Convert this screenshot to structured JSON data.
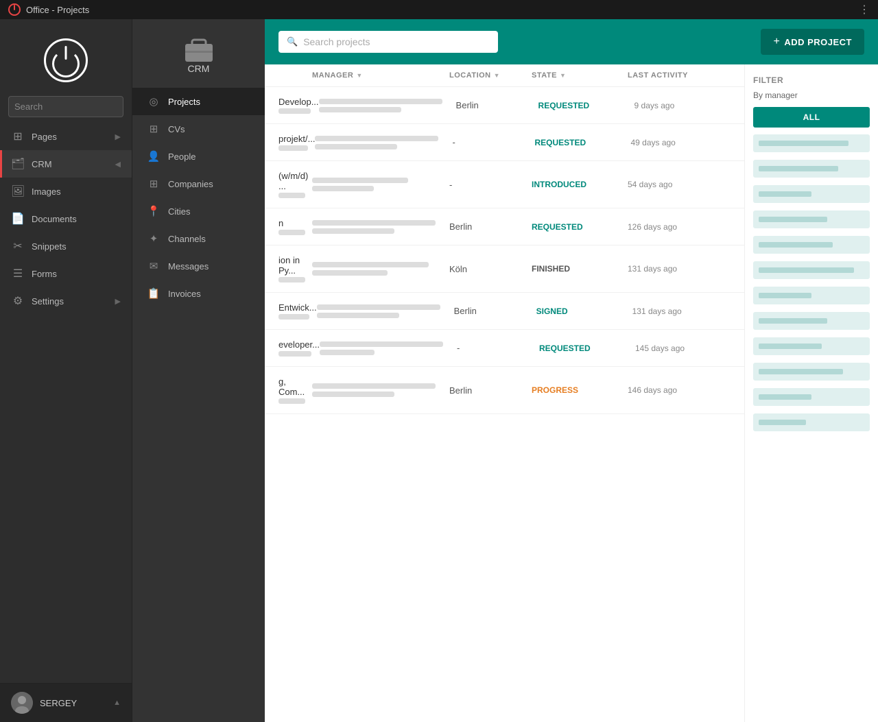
{
  "app": {
    "title": "Office - Projects"
  },
  "left_sidebar": {
    "search_placeholder": "Search",
    "nav_items": [
      {
        "id": "pages",
        "label": "Pages",
        "has_arrow": true
      },
      {
        "id": "crm",
        "label": "CRM",
        "has_arrow": true,
        "active": true
      },
      {
        "id": "images",
        "label": "Images",
        "has_arrow": false
      },
      {
        "id": "documents",
        "label": "Documents",
        "has_arrow": false
      },
      {
        "id": "snippets",
        "label": "Snippets",
        "has_arrow": false
      },
      {
        "id": "forms",
        "label": "Forms",
        "has_arrow": false
      },
      {
        "id": "settings",
        "label": "Settings",
        "has_arrow": true
      }
    ],
    "user": {
      "name": "SERGEY"
    }
  },
  "crm_sidebar": {
    "title": "CRM",
    "items": [
      {
        "id": "projects",
        "label": "Projects",
        "active": true
      },
      {
        "id": "cvs",
        "label": "CVs"
      },
      {
        "id": "people",
        "label": "People"
      },
      {
        "id": "companies",
        "label": "Companies"
      },
      {
        "id": "cities",
        "label": "Cities"
      },
      {
        "id": "channels",
        "label": "Channels"
      },
      {
        "id": "messages",
        "label": "Messages"
      },
      {
        "id": "invoices",
        "label": "Invoices"
      }
    ]
  },
  "header": {
    "search_placeholder": "Search projects",
    "add_button_label": "ADD PROJECT"
  },
  "table": {
    "columns": [
      "MANAGER",
      "LOCATION",
      "STATE",
      "LAST ACTIVITY"
    ],
    "rows": [
      {
        "name": "Develop...",
        "location": "Berlin",
        "state": "REQUESTED",
        "state_class": "state-requested",
        "activity": "9 days ago"
      },
      {
        "name": "projekt/...",
        "location": "-",
        "state": "REQUESTED",
        "state_class": "state-requested",
        "activity": "49 days ago"
      },
      {
        "name": "(w/m/d) ...",
        "location": "-",
        "state": "INTRODUCED",
        "state_class": "state-introduced",
        "activity": "54 days ago"
      },
      {
        "name": "n",
        "location": "Berlin",
        "state": "REQUESTED",
        "state_class": "state-requested",
        "activity": "126 days ago"
      },
      {
        "name": "ion in Py...",
        "location": "Köln",
        "state": "FINISHED",
        "state_class": "state-finished",
        "activity": "131 days ago"
      },
      {
        "name": "Entwick...",
        "location": "Berlin",
        "state": "SIGNED",
        "state_class": "state-signed",
        "activity": "131 days ago"
      },
      {
        "name": "eveloper...",
        "location": "-",
        "state": "REQUESTED",
        "state_class": "state-requested",
        "activity": "145 days ago"
      },
      {
        "name": "g, Com...",
        "location": "Berlin",
        "state": "PROGRESS",
        "state_class": "state-progress",
        "activity": "146 days ago"
      }
    ]
  },
  "filter": {
    "title": "FILTER",
    "subtitle": "By manager",
    "all_label": "ALL",
    "items_count": 12
  },
  "colors": {
    "teal": "#00897b",
    "dark_teal": "#00695c",
    "accent_red": "#e84444"
  }
}
